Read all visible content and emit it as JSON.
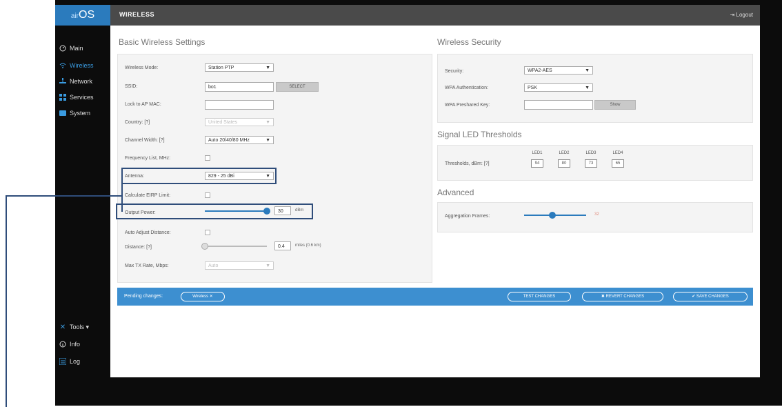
{
  "app": {
    "logo_prefix": "air",
    "logo_main": "OS",
    "page_title": "WIRELESS",
    "logout_label": "Logout"
  },
  "sidebar": {
    "items": [
      {
        "label": "Main",
        "icon": "gauge-icon"
      },
      {
        "label": "Wireless",
        "icon": "wifi-icon"
      },
      {
        "label": "Network",
        "icon": "network-icon"
      },
      {
        "label": "Services",
        "icon": "services-icon"
      },
      {
        "label": "System",
        "icon": "system-icon"
      }
    ],
    "bottom_items": [
      {
        "label": "Tools ▾",
        "icon": "tools-icon"
      },
      {
        "label": "Info",
        "icon": "info-icon"
      },
      {
        "label": "Log",
        "icon": "log-icon"
      }
    ]
  },
  "basic": {
    "title": "Basic Wireless Settings",
    "wireless_mode": {
      "label": "Wireless Mode:",
      "value": "Station PTP"
    },
    "ssid": {
      "label": "SSID:",
      "value": "bo1",
      "button": "SELECT"
    },
    "lock_ap": {
      "label": "Lock to AP MAC:",
      "value": ""
    },
    "country": {
      "label": "Country: [?]",
      "value": "United States"
    },
    "channel_width": {
      "label": "Channel Width: [?]",
      "value": "Auto 20/40/80 MHz"
    },
    "frequency_list": {
      "label": "Frequency List, MHz:"
    },
    "antenna": {
      "label": "Antenna:",
      "value": "829 - 25 dBi"
    },
    "calculate_eirp": {
      "label": "Calculate EIRP Limit:"
    },
    "output_power": {
      "label": "Output Power:",
      "value": "30",
      "unit": "dBm",
      "level": 1.0
    },
    "auto_adjust": {
      "label": "Auto Adjust Distance:"
    },
    "distance": {
      "label": "Distance: [?]",
      "value": "0.4",
      "unit": "miles (0.6 km)",
      "level": 0.0
    },
    "max_tx_rate": {
      "label": "Max TX Rate, Mbps:",
      "value": "Auto"
    }
  },
  "security": {
    "title": "Wireless Security",
    "security": {
      "label": "Security:",
      "value": "WPA2-AES"
    },
    "wpa_auth": {
      "label": "WPA Authentication:",
      "value": "PSK"
    },
    "wpa_key": {
      "label": "WPA Preshared Key:",
      "value": "",
      "button": "Show"
    }
  },
  "led": {
    "title": "Signal LED Thresholds",
    "label": "Thresholds, dBm: [?]",
    "leds": [
      {
        "name": "LED1",
        "value": "94"
      },
      {
        "name": "LED2",
        "value": "80"
      },
      {
        "name": "LED3",
        "value": "73"
      },
      {
        "name": "LED4",
        "value": "65"
      }
    ]
  },
  "advanced": {
    "title": "Advanced",
    "aggregation": {
      "label": "Aggregation Frames:",
      "value": "32",
      "level": 0.45
    }
  },
  "pending": {
    "label": "Pending changes:",
    "tag": "Wireless ✕",
    "test_btn": "TEST CHANGES",
    "revert_btn": "✖ REVERT CHANGES",
    "save_btn": "✔ SAVE CHANGES"
  },
  "colors": {
    "accent": "#2b7bbd",
    "pending_bar": "#3d8fd0",
    "highlight": "#2f4d7a",
    "frame": "#0c0c0c"
  }
}
